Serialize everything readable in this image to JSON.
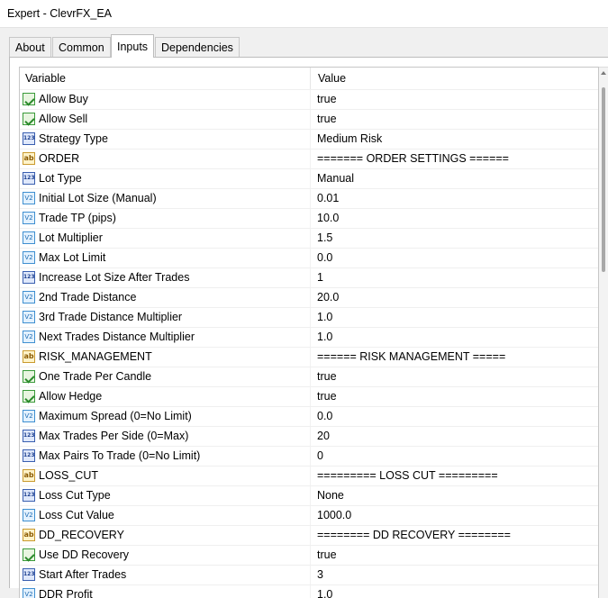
{
  "window": {
    "title": "Expert - ClevrFX_EA"
  },
  "tabs": [
    {
      "label": "About",
      "active": false
    },
    {
      "label": "Common",
      "active": false
    },
    {
      "label": "Inputs",
      "active": true
    },
    {
      "label": "Dependencies",
      "active": false
    }
  ],
  "table": {
    "headers": {
      "variable": "Variable",
      "value": "Value"
    },
    "rows": [
      {
        "type": "bool",
        "name": "Allow Buy",
        "value": "true"
      },
      {
        "type": "bool",
        "name": "Allow Sell",
        "value": "true"
      },
      {
        "type": "int",
        "name": "Strategy Type",
        "value": "Medium Risk"
      },
      {
        "type": "str",
        "name": "ORDER",
        "value": "======= ORDER SETTINGS ======"
      },
      {
        "type": "int",
        "name": "Lot Type",
        "value": "Manual"
      },
      {
        "type": "dbl",
        "name": "Initial Lot Size (Manual)",
        "value": "0.01"
      },
      {
        "type": "dbl",
        "name": "Trade TP (pips)",
        "value": "10.0"
      },
      {
        "type": "dbl",
        "name": "Lot Multiplier",
        "value": "1.5"
      },
      {
        "type": "dbl",
        "name": "Max Lot Limit",
        "value": "0.0"
      },
      {
        "type": "int",
        "name": "Increase Lot Size After Trades",
        "value": "1"
      },
      {
        "type": "dbl",
        "name": "2nd Trade Distance",
        "value": "20.0"
      },
      {
        "type": "dbl",
        "name": "3rd Trade Distance Multiplier",
        "value": "1.0"
      },
      {
        "type": "dbl",
        "name": "Next Trades Distance Multiplier",
        "value": "1.0"
      },
      {
        "type": "str",
        "name": "RISK_MANAGEMENT",
        "value": "====== RISK MANAGEMENT ====="
      },
      {
        "type": "bool",
        "name": "One Trade Per Candle",
        "value": "true"
      },
      {
        "type": "bool",
        "name": "Allow Hedge",
        "value": "true"
      },
      {
        "type": "dbl",
        "name": "Maximum Spread (0=No Limit)",
        "value": "0.0"
      },
      {
        "type": "int",
        "name": "Max Trades Per Side (0=Max)",
        "value": "20"
      },
      {
        "type": "int",
        "name": "Max Pairs To Trade (0=No Limit)",
        "value": "0"
      },
      {
        "type": "str",
        "name": "LOSS_CUT",
        "value": "========= LOSS CUT ========="
      },
      {
        "type": "int",
        "name": "Loss Cut Type",
        "value": "None"
      },
      {
        "type": "dbl",
        "name": "Loss Cut Value",
        "value": "1000.0"
      },
      {
        "type": "str",
        "name": "DD_RECOVERY",
        "value": "======== DD RECOVERY ========"
      },
      {
        "type": "bool",
        "name": "Use DD Recovery",
        "value": "true"
      },
      {
        "type": "int",
        "name": "Start After Trades",
        "value": "3"
      },
      {
        "type": "dbl",
        "name": "DDR Profit",
        "value": "1.0"
      }
    ]
  },
  "icons": {
    "bool": "checkbox-icon",
    "int": "integer-icon",
    "dbl": "double-icon",
    "str": "string-icon"
  },
  "icon_glyphs": {
    "int": "123",
    "dbl": "V2",
    "str": "ab"
  }
}
